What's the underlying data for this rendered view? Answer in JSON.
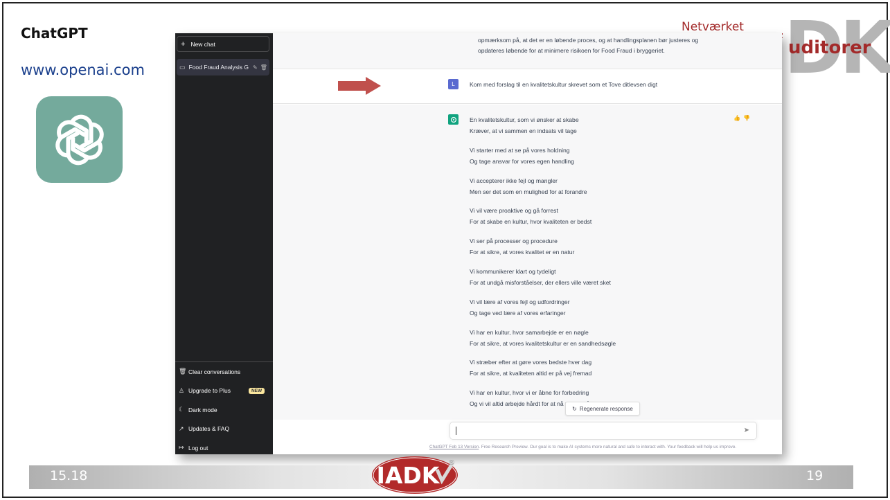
{
  "slide": {
    "title": "ChatGPT",
    "url": "www.openai.com",
    "left_number": "15.18",
    "right_number": "19"
  },
  "brand": {
    "netvaerket": "Netværket",
    "dk": "DK",
    "auditorer": "uditorer",
    "iadk": "IADK",
    "registered": "®"
  },
  "sidebar": {
    "new_chat": "New chat",
    "chat_title": "Food Fraud Analysis G",
    "bottom_items": [
      {
        "label": "Clear conversations",
        "icon": "trash-icon"
      },
      {
        "label": "Upgrade to Plus",
        "icon": "user-icon",
        "badge": "NEW"
      },
      {
        "label": "Dark mode",
        "icon": "moon-icon"
      },
      {
        "label": "Updates & FAQ",
        "icon": "external-link-icon"
      },
      {
        "label": "Log out",
        "icon": "logout-icon"
      }
    ]
  },
  "conversation": {
    "previous_lines": [
      "opmærksom på, at det er en løbende proces, og at handlingsplanen bør justeres og",
      "opdateres løbende for at minimere risikoen for Food Fraud i bryggeriet."
    ],
    "user_avatar": "L",
    "user_message": "Kom med forslag til en kvalitetskultur skrevet som et Tove ditlevsen digt",
    "poem": [
      [
        "En kvalitetskultur, som vi ønsker at skabe",
        "Kræver, at vi sammen en indsats vil tage"
      ],
      [
        "Vi starter med at se på vores holdning",
        "Og tage ansvar for vores egen handling"
      ],
      [
        "Vi accepterer ikke fejl og mangler",
        "Men ser det som en mulighed for at forandre"
      ],
      [
        "Vi vil være proaktive og gå forrest",
        "For at skabe en kultur, hvor kvaliteten er bedst"
      ],
      [
        "Vi ser på processer og procedure",
        "For at sikre, at vores kvalitet er en natur"
      ],
      [
        "Vi kommunikerer klart og tydeligt",
        "For at undgå misforståelser, der ellers ville været sket"
      ],
      [
        "Vi vil lære af vores fejl og udfordringer",
        "Og tage ved lære af vores erfaringer"
      ],
      [
        "Vi har en kultur, hvor samarbejde er en nøgle",
        "For at sikre, at vores kvalitetskultur er en sandhedsøgle"
      ],
      [
        "Vi stræber efter at gøre vores bedste hver dag",
        "For at sikre, at kvaliteten altid er på vej fremad"
      ],
      [
        "Vi har en kultur, hvor vi er åbne for forbedring",
        "Og vi vil altid arbejde hårdt for at nå vores målsætning"
      ]
    ],
    "regenerate": "Regenerate response",
    "footer_link": "ChatGPT Feb 13 Version",
    "footer_text": ". Free Research Preview. Our goal is to make AI systems more natural and safe to interact with. Your feedback will help us improve."
  },
  "colors": {
    "sidebar_bg": "#202123",
    "chatgpt_green": "#10a37f",
    "logo_tile": "#74aa9c",
    "arrow": "#c0504d",
    "brand_red": "#a32a2a"
  }
}
